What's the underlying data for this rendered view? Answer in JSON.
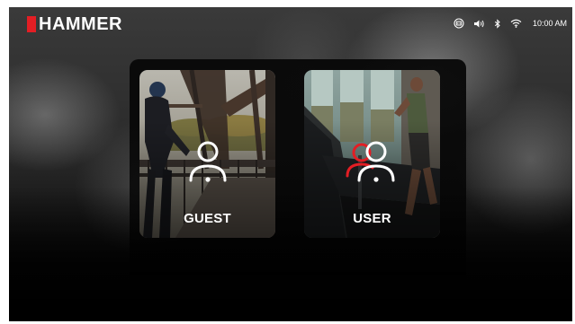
{
  "brand": {
    "name": "HAMMER",
    "accent_color": "#e31e24"
  },
  "status_bar": {
    "icons": [
      "hdmi-icon",
      "volume-icon",
      "bluetooth-icon",
      "wifi-icon"
    ],
    "time": "10:00 AM"
  },
  "profiles": [
    {
      "label": "GUEST",
      "icon": "guest-person-icon"
    },
    {
      "label": "USER",
      "icon": "user-group-icon"
    }
  ]
}
